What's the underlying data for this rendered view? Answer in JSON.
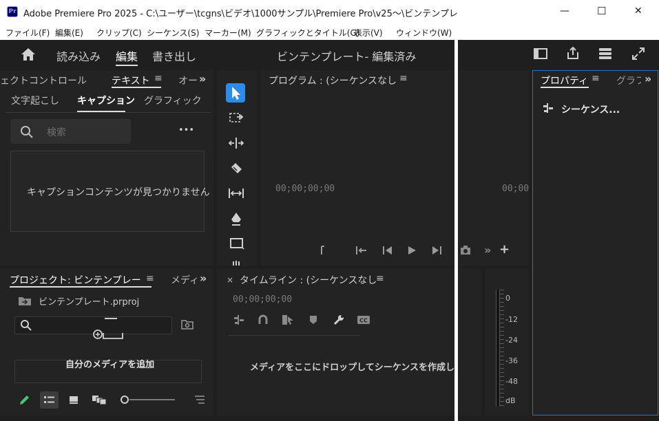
{
  "window": {
    "title": "Adobe Premiere Pro 2025 - C:\\ユーザー\\tcgns\\ビデオ\\1000サンプル\\Premiere Pro\\v25～\\ビンテンプレート.prproj",
    "app_icon": "Pr",
    "controls": {
      "minimize": "—",
      "maximize": "☐",
      "close": "✕"
    }
  },
  "menu": [
    "ファイル(F)",
    "編集(E)",
    "クリップ(C)",
    "シーケンス(S)",
    "マーカー(M)",
    "グラフィックとタイトル(G)",
    "表示(V)",
    "ウィンドウ(W)"
  ],
  "header": {
    "workspaces": [
      "読み込み",
      "編集",
      "書き出し"
    ],
    "active_workspace": "編集",
    "project_title": "ビンテンプレート- 編集済み"
  },
  "text_panel": {
    "tabs": [
      "ェクトコントロール",
      "テキスト",
      "オー"
    ],
    "active_tab": "テキスト",
    "subtabs": [
      "文字起こし",
      "キャプション",
      "グラフィック"
    ],
    "active_subtab": "キャプション",
    "search_placeholder": "検索",
    "more": "•••",
    "empty_message": "キャプションコンテンツが見つかりません"
  },
  "program_monitor": {
    "title": "プログラム : (シーケンスなし",
    "timecode_left": "00;00;00;00",
    "timecode_right": "00;00"
  },
  "properties_panel": {
    "tabs": [
      "プロパティ",
      "グラフ"
    ],
    "active_tab": "プロパティ",
    "item": "シーケンス..."
  },
  "project_panel": {
    "tabs": [
      "プロジェクト: ビンテンプレー",
      "メディ"
    ],
    "file": "ビンテンプレート.prproj",
    "add_media": "自分のメディアを追加"
  },
  "timeline": {
    "title": "タイムライン : (シーケンスなし",
    "timecode": "00;00;00;00",
    "drop_message": "メディアをここにドロップしてシーケンスを作成しま"
  },
  "audio_meter": {
    "ticks": [
      "0",
      "-12",
      "-24",
      "-36",
      "-48",
      "dB"
    ]
  },
  "colors": {
    "accent_blue": "#2d8ceb",
    "panel_bg": "#232323",
    "app_bg": "#1f1f1f"
  }
}
